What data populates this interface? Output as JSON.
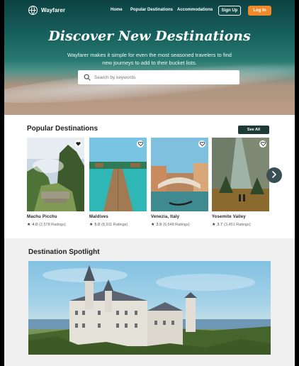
{
  "nav": {
    "brand": "Wayfarer",
    "links": [
      "Home",
      "Popular Destinations",
      "Accommodations"
    ],
    "signup_label": "Sign Up",
    "login_label": "Log In"
  },
  "hero": {
    "title": "Discover New Destinations",
    "subtitle": "Wayfarer makes it simple for even the most seasoned travelers to find new journeys to add to their bucket lists.",
    "search": {
      "placeholder": "Search by keywords"
    }
  },
  "popular": {
    "title": "Popular Destinations",
    "see_all_label": "See All",
    "cards": [
      {
        "name": "Machu Picchu",
        "score": "4.0",
        "ratings": "(2,578 Ratings)"
      },
      {
        "name": "Maldives",
        "score": "5.0",
        "ratings": "(8,911 Ratings)"
      },
      {
        "name": "Venezia, Italy",
        "score": "3.9",
        "ratings": "(6,648 Ratings)"
      },
      {
        "name": "Yosemite Valley",
        "score": "3.7",
        "ratings": "(3,451 Ratings)"
      }
    ]
  },
  "spotlight": {
    "title": "Destination Spotlight"
  },
  "colors": {
    "accent": "#ee8a2c",
    "dark_green": "#1d3b35",
    "teal": "#1b6e6a"
  },
  "icons": [
    "globe-icon",
    "search-icon",
    "heart-icon",
    "star-icon",
    "chevron-right-icon"
  ]
}
